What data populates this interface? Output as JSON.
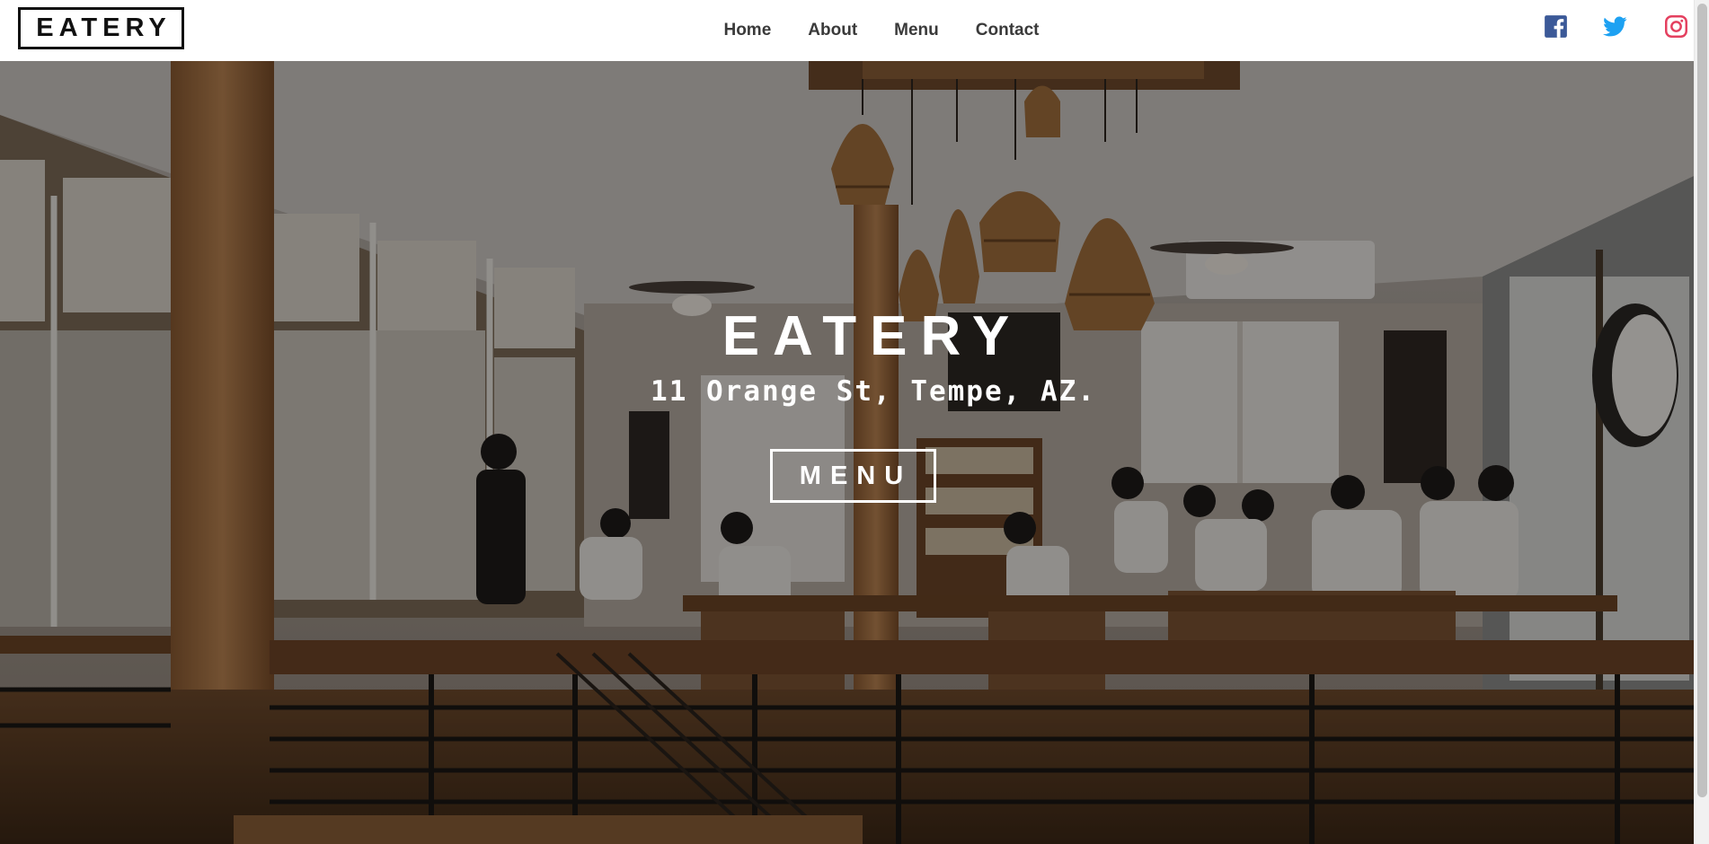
{
  "header": {
    "logo": "EATERY",
    "nav": [
      {
        "label": "Home"
      },
      {
        "label": "About"
      },
      {
        "label": "Menu"
      },
      {
        "label": "Contact"
      }
    ],
    "social": [
      {
        "icon": "facebook-icon",
        "color": "#3b5998"
      },
      {
        "icon": "twitter-icon",
        "color": "#1da1f2"
      },
      {
        "icon": "instagram-icon",
        "color": "#e4405f"
      }
    ]
  },
  "hero": {
    "title": "EATERY",
    "address": "11 Orange St, Tempe, AZ.",
    "button_label": "MENU",
    "background": "cafe-interior-photo"
  }
}
